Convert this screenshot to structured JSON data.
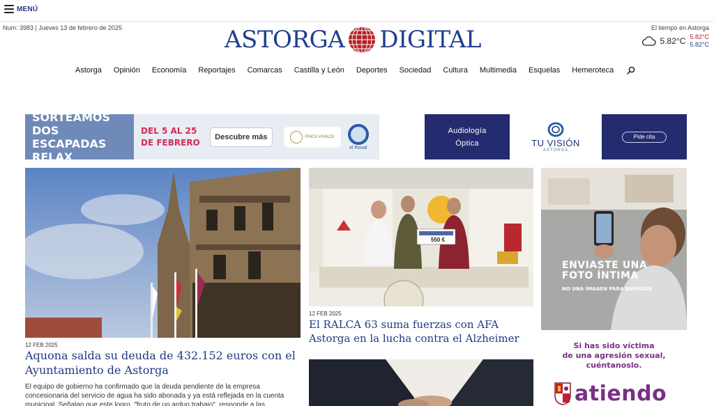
{
  "header": {
    "menu_label": "MENÚ",
    "edition": "Num: 3983 | Jueves 13 de febrero de 2025",
    "logo_left": "ASTORGA",
    "logo_right": "DIGITAL",
    "weather": {
      "label": "El tiempo en Astorga",
      "temp": "5.82°C",
      "max": "5.82°C",
      "min": "5.82°C",
      "icon": "cloud-icon"
    }
  },
  "nav": {
    "items": [
      "Astorga",
      "Opinión",
      "Economía",
      "Reportajes",
      "Comarcas",
      "Castilla y León",
      "Deportes",
      "Sociedad",
      "Cultura",
      "Multimedia",
      "Esquelas",
      "Hemeroteca"
    ],
    "search_icon": "search-icon"
  },
  "ads": {
    "relax": {
      "line1": "SORTEAMOS DOS",
      "line2": "ESCAPADAS RELAX",
      "date_line1": "DEL 5 AL 25",
      "date_line2": "DE FEBRERO",
      "button": "Descubre más",
      "partner1": "FINCA VIVALDI",
      "partner2": "el Rosal"
    },
    "vision": {
      "line1": "Audiología",
      "line2": "Óptica",
      "brand": "TU VISIÓN",
      "city": "ASTORGA",
      "button": "Pide cita"
    },
    "side1": {
      "headline_line1": "ENVIASTE UNA",
      "headline_line2": "FOTO ÍNTIMA",
      "sub": "NO UNA IMAGEN PARA DIFUNDIR"
    },
    "side2": {
      "line1": "Si has sido víctima",
      "line2": "de una agresión sexual,",
      "line3": "cuéntanoslo.",
      "brand": "atiendo"
    }
  },
  "articles": {
    "main": {
      "date": "12 FEB 2025",
      "title": "Aquona salda su deuda de 432.152 euros con el Ayuntamiento de Astorga",
      "excerpt": "El equipo de gobierno ha confirmado que la deuda pendiente de la empresa concesionaria del servicio de agua ha sido abonada y ya está reflejada en la cuenta municipal. Señalan que este logro, \"fruto de un arduo trabajo\", responde a las"
    },
    "second": {
      "date": "12 FEB 2025",
      "title": "El RALCA 63 suma fuerzas con AFA Astorga en la lucha contra el Alzheimer",
      "cheque": "550 €"
    }
  },
  "colors": {
    "brand_blue": "#1f3f8e",
    "link_blue": "#1f3a80",
    "ad_navy": "#242b6e",
    "purple": "#7a2f86"
  }
}
